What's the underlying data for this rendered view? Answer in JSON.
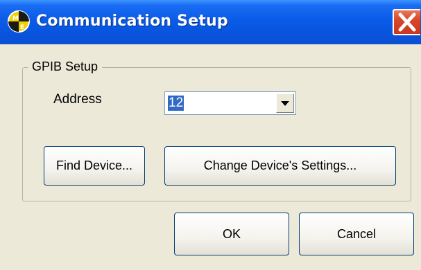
{
  "window": {
    "title": "Communication Setup",
    "icon": "mpe-app-icon",
    "close_icon": "close-icon"
  },
  "group": {
    "label": "GPIB Setup",
    "address_label": "Address",
    "address_value": "12",
    "find_device_label": "Find Device...",
    "change_settings_label": "Change Device's Settings..."
  },
  "footer": {
    "ok_label": "OK",
    "cancel_label": "Cancel"
  },
  "colors": {
    "titlebar": "#0a5ce8",
    "close_button": "#d9472a",
    "dialog_background": "#ece9d8",
    "selection": "#316ac5"
  }
}
